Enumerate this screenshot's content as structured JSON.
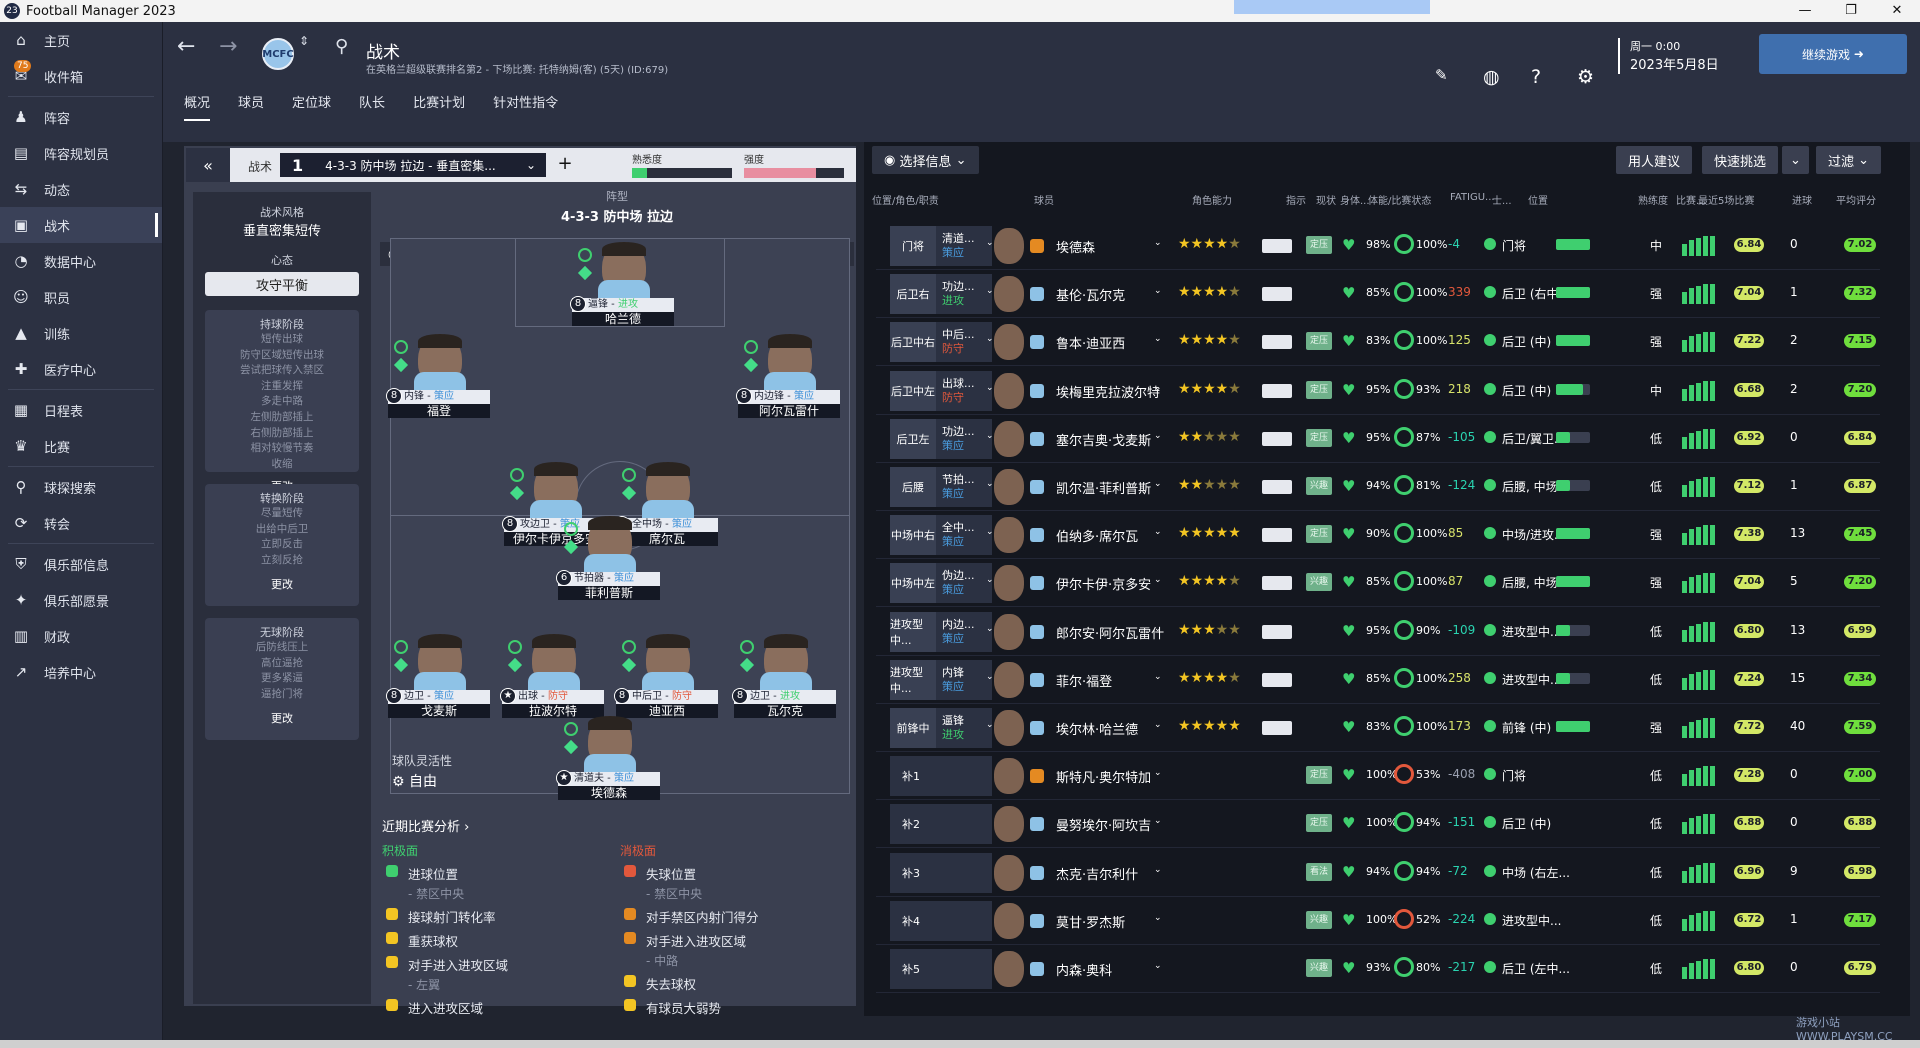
{
  "app": {
    "title": "Football Manager 2023",
    "logo": "23"
  },
  "sidebar": {
    "items": [
      {
        "label": "主页",
        "icon": "home-icon"
      },
      {
        "label": "收件箱",
        "icon": "inbox-icon",
        "badge": "75"
      },
      {
        "label": "阵容",
        "icon": "squad-icon"
      },
      {
        "label": "阵容规划员",
        "icon": "planner-icon"
      },
      {
        "label": "动态",
        "icon": "dynamics-icon"
      },
      {
        "label": "战术",
        "icon": "tactics-icon",
        "active": true
      },
      {
        "label": "数据中心",
        "icon": "data-icon"
      },
      {
        "label": "职员",
        "icon": "staff-icon"
      },
      {
        "label": "训练",
        "icon": "training-icon"
      },
      {
        "label": "医疗中心",
        "icon": "medical-icon"
      },
      {
        "label": "日程表",
        "icon": "calendar-icon"
      },
      {
        "label": "比赛",
        "icon": "trophy-icon"
      },
      {
        "label": "球探搜索",
        "icon": "scouting-icon"
      },
      {
        "label": "转会",
        "icon": "transfer-icon"
      },
      {
        "label": "俱乐部信息",
        "icon": "club-icon"
      },
      {
        "label": "俱乐部愿景",
        "icon": "vision-icon"
      },
      {
        "label": "财政",
        "icon": "finance-icon"
      },
      {
        "label": "培养中心",
        "icon": "development-icon"
      }
    ]
  },
  "header": {
    "title": "战术",
    "subtitle": "在英格兰超级联赛排名第2 - 下场比赛: 托特纳姆(客) (5天) (ID:679)",
    "date_line1": "周一 0:00",
    "date_line2": "2023年5月8日",
    "continue": "继续游戏"
  },
  "tabs": [
    "概况",
    "球员",
    "定位球",
    "队长",
    "比赛计划",
    "针对性指令"
  ],
  "tactic": {
    "label": "战术",
    "slot": "1",
    "name": "4-3-3 防中场 拉边 - 垂直密集...",
    "familiarity_label": "熟悉度",
    "familiarity": 0.15,
    "intensity_label": "强度",
    "intensity": 0.72,
    "style_title": "战术风格",
    "style": "垂直密集短传",
    "mentality_title": "心态",
    "mentality": "攻守平衡",
    "in_possession_title": "持球阶段",
    "in_possession": [
      "短传出球",
      "防守区域短传出球",
      "尝试把球传入禁区",
      "注重发挥",
      "多走中路",
      "左侧肋部插上",
      "右侧肋部插上",
      "相对较慢节奏",
      "收缩"
    ],
    "transition_title": "转换阶段",
    "transition": [
      "尽量短传",
      "出给中后卫",
      "立即反击",
      "立刻反抢"
    ],
    "out_possession_title": "无球阶段",
    "out_possession": [
      "后防线压上",
      "高位逼抢",
      "更多紧逼",
      "逼抢门将"
    ],
    "more": "更改",
    "formation_title": "阵型",
    "formation": "4-3-3 防中场 拉边",
    "analysis_btn": "分析",
    "flex_label": "球队灵活性",
    "flex_value": "自由"
  },
  "pitch_players": [
    {
      "role": "逼锋",
      "duty": "进攻",
      "name": "哈兰德",
      "num": "8"
    },
    {
      "role": "内锋",
      "duty": "策应",
      "name": "福登",
      "num": "8"
    },
    {
      "role": "内边锋",
      "duty": "策应",
      "name": "阿尔瓦雷什",
      "num": "8"
    },
    {
      "role": "攻边卫",
      "duty": "策应",
      "name": "伊尔卡伊京多安",
      "num": "8"
    },
    {
      "role": "全中场",
      "duty": "策应",
      "name": "席尔瓦",
      "num": "8"
    },
    {
      "role": "节拍器",
      "duty": "策应",
      "name": "菲利普斯",
      "num": "6"
    },
    {
      "role": "边卫",
      "duty": "策应",
      "name": "戈麦斯",
      "num": "8"
    },
    {
      "role": "出球",
      "duty": "防守",
      "name": "拉波尔特",
      "num": "★"
    },
    {
      "role": "中后卫",
      "duty": "防守",
      "name": "迪亚西",
      "num": "8"
    },
    {
      "role": "边卫",
      "duty": "进攻",
      "name": "瓦尔克",
      "num": "8"
    },
    {
      "role": "清道夫",
      "duty": "策应",
      "name": "埃德森",
      "num": "★"
    }
  ],
  "analysis": {
    "title": "近期比赛分析",
    "pos_label": "积极面",
    "neg_label": "消极面",
    "positives": [
      {
        "t": "进球位置",
        "s": "- 禁区中央"
      },
      {
        "t": "接球射门转化率",
        "s": ""
      },
      {
        "t": "重获球权",
        "s": ""
      },
      {
        "t": "对手进入进攻区域",
        "s": "- 左翼"
      },
      {
        "t": "进入进攻区域",
        "s": ""
      }
    ],
    "negatives": [
      {
        "t": "失球位置",
        "s": "- 禁区中央"
      },
      {
        "t": "对手禁区内射门得分",
        "s": ""
      },
      {
        "t": "对手进入进攻区域",
        "s": "- 中路"
      },
      {
        "t": "失去球权",
        "s": ""
      },
      {
        "t": "有球员大弱势",
        "s": ""
      }
    ]
  },
  "right": {
    "select": "选择信息",
    "advice": "用人建议",
    "quickpick": "快速挑选",
    "filter": "过滤",
    "headers": [
      "位置/角色/职责",
      "球员",
      "角色能力",
      "指示",
      "现状",
      "身体...",
      "体能/比赛状态",
      "FATIGU...",
      "士...",
      "位置",
      "熟练度",
      "比赛...",
      "最近5场比赛",
      "进球",
      "平均评分"
    ]
  },
  "rows": [
    {
      "pos": "门将",
      "role": "清道...",
      "duty": "策应",
      "dk": "sup",
      "name": "埃德森",
      "gk": true,
      "stars": 4,
      "half": false,
      "status": "定压",
      "cond": "98%",
      "sharp": "100%",
      "fatig": "-4",
      "fk": "neg",
      "ppos": "门将",
      "fam": 1,
      "str": "中",
      "rating": "6.84",
      "goals": "0",
      "avg": "7.02",
      "avgk": "g"
    },
    {
      "pos": "后卫右",
      "role": "功边...",
      "duty": "进攻",
      "dk": "att",
      "name": "基伦·瓦尔克",
      "stars": 3,
      "half": true,
      "status": "",
      "cond": "85%",
      "sharp": "100%",
      "fatig": "339",
      "fk": "red",
      "ppos": "后卫 (右中...",
      "fam": 1,
      "str": "强",
      "rating": "7.04",
      "goals": "1",
      "avg": "7.32",
      "avgk": "g"
    },
    {
      "pos": "后卫中右",
      "role": "中后...",
      "duty": "防守",
      "dk": "def",
      "name": "鲁本·迪亚西",
      "stars": 4,
      "half": false,
      "status": "定压",
      "cond": "83%",
      "sharp": "100%",
      "fatig": "125",
      "fk": "yel",
      "ppos": "后卫 (中)",
      "fam": 1,
      "str": "强",
      "rating": "7.22",
      "goals": "2",
      "avg": "7.15",
      "avgk": "g"
    },
    {
      "pos": "后卫中左",
      "role": "出球...",
      "duty": "防守",
      "dk": "def",
      "name": "埃梅里克拉波尔特",
      "stars": 4,
      "half": false,
      "status": "定压",
      "cond": "95%",
      "sharp": "93%",
      "fatig": "218",
      "fk": "yel",
      "ppos": "后卫 (中)",
      "fam": 0.8,
      "str": "中",
      "rating": "6.68",
      "goals": "2",
      "avg": "7.20",
      "avgk": "g"
    },
    {
      "pos": "后卫左",
      "role": "功边...",
      "duty": "策应",
      "dk": "sup",
      "name": "塞尔吉奥·戈麦斯",
      "stars": 2,
      "half": false,
      "status": "定压",
      "cond": "95%",
      "sharp": "87%",
      "fatig": "-105",
      "fk": "neg",
      "ppos": "后卫/翼卫...",
      "fam": 0.4,
      "str": "低",
      "rating": "6.92",
      "goals": "0",
      "avg": "6.84",
      "avgk": "y"
    },
    {
      "pos": "后腰",
      "role": "节拍...",
      "duty": "策应",
      "dk": "sup",
      "name": "凯尔温·菲利普斯",
      "stars": 2,
      "half": false,
      "status": "兴趣",
      "cond": "94%",
      "sharp": "81%",
      "fatig": "-124",
      "fk": "neg",
      "ppos": "后腰, 中场...",
      "fam": 0.4,
      "str": "低",
      "rating": "7.12",
      "goals": "1",
      "avg": "6.87",
      "avgk": "y"
    },
    {
      "pos": "中场中右",
      "role": "全中...",
      "duty": "策应",
      "dk": "sup",
      "name": "伯纳多·席尔瓦",
      "stars": 4,
      "half": true,
      "status": "定压",
      "cond": "90%",
      "sharp": "100%",
      "fatig": "85",
      "fk": "yel",
      "ppos": "中场/进攻...",
      "fam": 1,
      "str": "强",
      "rating": "7.38",
      "goals": "13",
      "avg": "7.45",
      "avgk": "g"
    },
    {
      "pos": "中场中左",
      "role": "伪边...",
      "duty": "策应",
      "dk": "sup",
      "name": "伊尔卡伊·京多安",
      "stars": 3,
      "half": true,
      "status": "兴趣",
      "cond": "85%",
      "sharp": "100%",
      "fatig": "87",
      "fk": "yel",
      "ppos": "后腰, 中场...",
      "fam": 1,
      "str": "强",
      "rating": "7.04",
      "goals": "5",
      "avg": "7.20",
      "avgk": "g"
    },
    {
      "pos": "进攻型中...",
      "role": "内边...",
      "duty": "策应",
      "dk": "sup",
      "name": "郎尔安·阿尔瓦雷什",
      "stars": 2,
      "half": true,
      "status": "",
      "cond": "95%",
      "sharp": "90%",
      "fatig": "-109",
      "fk": "neg",
      "ppos": "进攻型中...",
      "fam": 0.4,
      "str": "低",
      "rating": "6.80",
      "goals": "13",
      "avg": "6.99",
      "avgk": "y"
    },
    {
      "pos": "进攻型中...",
      "role": "内锋",
      "duty": "策应",
      "dk": "sup",
      "name": "菲尔·福登",
      "stars": 3,
      "half": true,
      "status": "",
      "cond": "85%",
      "sharp": "100%",
      "fatig": "258",
      "fk": "yel",
      "ppos": "进攻型中...",
      "fam": 0.4,
      "str": "低",
      "rating": "7.24",
      "goals": "15",
      "avg": "7.34",
      "avgk": "g"
    },
    {
      "pos": "前锋中",
      "role": "逼锋",
      "duty": "进攻",
      "dk": "att",
      "name": "埃尔林·哈兰德",
      "stars": 5,
      "half": false,
      "status": "",
      "cond": "83%",
      "sharp": "100%",
      "fatig": "173",
      "fk": "yel",
      "ppos": "前锋 (中)",
      "fam": 1,
      "str": "强",
      "rating": "7.72",
      "goals": "40",
      "avg": "7.59",
      "avgk": "g"
    },
    {
      "pos": "补1",
      "sub": true,
      "name": "斯特凡·奥尔特加",
      "gk": true,
      "status": "定压",
      "cond": "100%",
      "sharp": "53%",
      "fatig": "-408",
      "fk": "grey",
      "ppos": "门将",
      "fam": 0,
      "str": "低",
      "rating": "7.28",
      "goals": "0",
      "avg": "7.00",
      "avgk": "g"
    },
    {
      "pos": "补2",
      "sub": true,
      "name": "曼努埃尔·阿坎吉",
      "status": "定压",
      "cond": "100%",
      "sharp": "94%",
      "fatig": "-151",
      "fk": "neg",
      "ppos": "后卫 (中)",
      "fam": 0,
      "str": "低",
      "rating": "6.88",
      "goals": "0",
      "avg": "6.88",
      "avgk": "y"
    },
    {
      "pos": "补3",
      "sub": true,
      "name": "杰克·吉尔利什",
      "status": "看法",
      "cond": "94%",
      "sharp": "94%",
      "fatig": "-72",
      "fk": "neg",
      "ppos": "中场 (右左...",
      "fam": 0,
      "str": "低",
      "rating": "6.96",
      "goals": "9",
      "avg": "6.98",
      "avgk": "y"
    },
    {
      "pos": "补4",
      "sub": true,
      "name": "莫甘·罗杰斯",
      "status": "兴趣",
      "cond": "100%",
      "sharp": "52%",
      "fatig": "-224",
      "fk": "neg",
      "ppos": "进攻型中...",
      "fam": 0,
      "str": "低",
      "rating": "6.72",
      "goals": "1",
      "avg": "7.17",
      "avgk": "g"
    },
    {
      "pos": "补5",
      "sub": true,
      "name": "内森·奥科",
      "status": "兴趣",
      "cond": "93%",
      "sharp": "80%",
      "fatig": "-217",
      "fk": "neg",
      "ppos": "后卫 (左中...",
      "fam": 0,
      "str": "低",
      "rating": "6.80",
      "goals": "0",
      "avg": "6.79",
      "avgk": "y"
    }
  ],
  "watermark": "游戏小站 WWW.PLAYSM.CC"
}
